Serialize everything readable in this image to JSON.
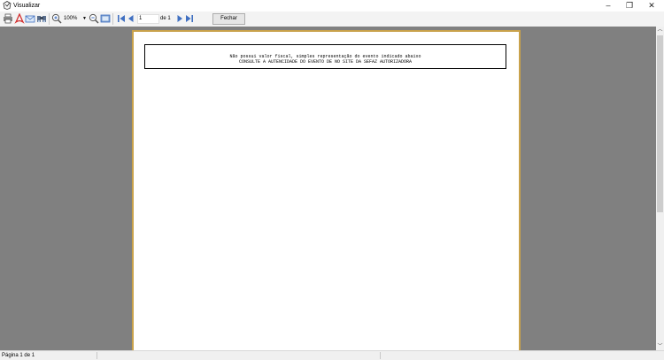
{
  "window": {
    "title": "Visualizar",
    "minimize_glyph": "–",
    "restore_glyph": "❐",
    "close_glyph": "✕"
  },
  "toolbar": {
    "icons": [
      "print-icon",
      "pdf-icon",
      "email-icon",
      "find-icon",
      "zoom-in-icon",
      "zoom-out-icon",
      "page-setup-icon",
      "first-page-icon",
      "prev-page-icon",
      "next-page-icon",
      "last-page-icon"
    ],
    "zoom_value": "100%",
    "page_value": "1",
    "page_of": "de 1",
    "close_label": "Fechar"
  },
  "document": {
    "line1": "Não possui valor fiscal, simples representação do evento indicado abaixo",
    "line2": "CONSULTE A AUTENCIDADE DO EVENTO DE  NO SITE DA SEFAZ AUTORIZADORA"
  },
  "status": {
    "page_info": "Página 1 de 1"
  },
  "colors": {
    "viewport_bg": "#808080",
    "page_border": "#c9a24b",
    "toolbar_bg": "#f3f3f3",
    "icon_blue": "#3f6fc1",
    "pdf_red": "#d32f2f"
  }
}
